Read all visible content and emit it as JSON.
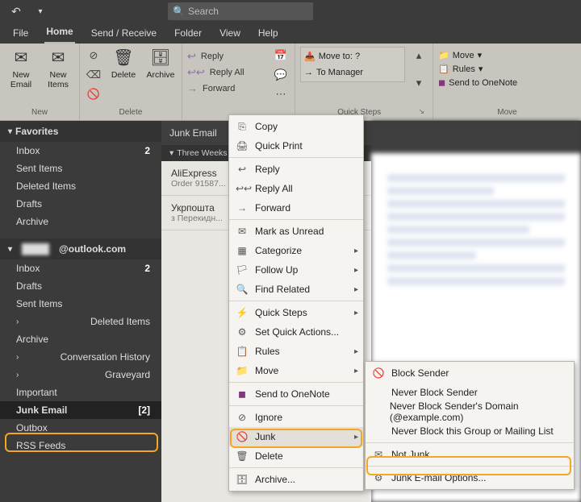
{
  "titlebar": {
    "search_placeholder": "Search"
  },
  "tabs": {
    "file": "File",
    "home": "Home",
    "sendreceive": "Send / Receive",
    "folder": "Folder",
    "view": "View",
    "help": "Help"
  },
  "ribbon": {
    "group_new": "New",
    "new_email": "New Email",
    "new_items": "New Items",
    "group_delete": "Delete",
    "delete": "Delete",
    "archive": "Archive",
    "reply": "Reply",
    "replyall": "Reply All",
    "forward": "Forward",
    "group_quicksteps": "Quick Steps",
    "moveto": "Move to: ?",
    "tomanager": "To Manager",
    "group_move": "Move",
    "move": "Move",
    "rules": "Rules",
    "onenote": "Send to OneNote"
  },
  "nav": {
    "favorites": "Favorites",
    "inbox": "Inbox",
    "inbox_count": "2",
    "sentitems": "Sent Items",
    "deleted": "Deleted Items",
    "drafts": "Drafts",
    "archive": "Archive",
    "account": "@outlook.com",
    "inbox2": "Inbox",
    "inbox2_count": "2",
    "drafts2": "Drafts",
    "sentitems2": "Sent Items",
    "deleted2": "Deleted Items",
    "archive2": "Archive",
    "conv": "Conversation History",
    "graveyard": "Graveyard",
    "important": "Important",
    "junk": "Junk Email",
    "junk_count": "[2]",
    "outbox": "Outbox",
    "rss": "RSS Feeds"
  },
  "list": {
    "header": "Junk Email",
    "group": "Three Weeks",
    "item1_title": "AliExpress",
    "item1_sub": "Order 91587...",
    "item2_title": "Укрпошта",
    "item2_sub": "з Перекидн..."
  },
  "ctx": {
    "copy": "Copy",
    "quickprint": "Quick Print",
    "reply": "Reply",
    "replyall": "Reply All",
    "forward": "Forward",
    "markunread": "Mark as Unread",
    "categorize": "Categorize",
    "followup": "Follow Up",
    "findrelated": "Find Related",
    "quicksteps": "Quick Steps",
    "setquick": "Set Quick Actions...",
    "rules": "Rules",
    "move": "Move",
    "onenote": "Send to OneNote",
    "ignore": "Ignore",
    "junk": "Junk",
    "delete": "Delete",
    "archive2": "Archive..."
  },
  "junkmenu": {
    "block": "Block Sender",
    "neverblock": "Never Block Sender",
    "neverdomain": "Never Block Sender's Domain (@example.com)",
    "nevergroup": "Never Block this Group or Mailing List",
    "notjunk": "Not Junk",
    "options": "Junk E-mail Options..."
  }
}
